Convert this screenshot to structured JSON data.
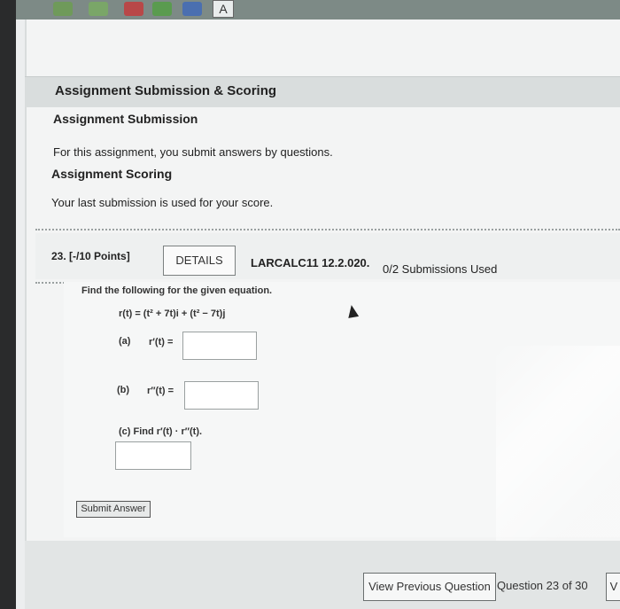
{
  "browser": {
    "toolbar_glyph": "A"
  },
  "assignment": {
    "header": "Assignment Submission & Scoring",
    "submission_title": "Assignment Submission",
    "submission_text": "For this assignment, you submit answers by questions.",
    "scoring_title": "Assignment Scoring",
    "scoring_text": "Your last submission is used for your score."
  },
  "question": {
    "number_points": "23. [-/10 Points]",
    "details_label": "DETAILS",
    "code": "LARCALC11 12.2.020.",
    "submissions_used": "0/2 Submissions Used",
    "prompt": "Find the following for the given equation.",
    "equation": "r(t) = (t² + 7t)i + (t² − 7t)j",
    "part_a_label": "(a)",
    "part_a_expr": "r′(t) =",
    "part_b_label": "(b)",
    "part_b_expr": "r″(t) =",
    "part_c_text": "(c) Find r′(t) · r″(t).",
    "submit_label": "Submit Answer"
  },
  "footer": {
    "view_previous_label": "View Previous Question",
    "question_counter": "Question 23 of 30",
    "next_label": "V"
  }
}
